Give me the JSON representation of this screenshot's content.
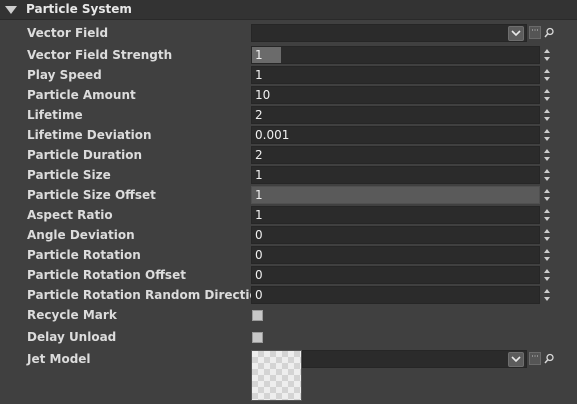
{
  "section": {
    "title": "Particle System"
  },
  "vector_field": {
    "label": "Vector Field",
    "value": ""
  },
  "properties": [
    {
      "label": "Vector Field Strength",
      "value": "1",
      "fill_fraction": 0.1
    },
    {
      "label": "Play Speed",
      "value": "1"
    },
    {
      "label": "Particle Amount",
      "value": "10"
    },
    {
      "label": "Lifetime",
      "value": "2"
    },
    {
      "label": "Lifetime Deviation",
      "value": "0.001"
    },
    {
      "label": "Particle Duration",
      "value": "2"
    },
    {
      "label": "Particle Size",
      "value": "1"
    },
    {
      "label": "Particle Size Offset",
      "value": "1",
      "highlighted": true
    },
    {
      "label": "Aspect Ratio",
      "value": "1"
    },
    {
      "label": "Angle Deviation",
      "value": "0"
    },
    {
      "label": "Particle Rotation",
      "value": "0"
    },
    {
      "label": "Particle Rotation Offset",
      "value": "0"
    },
    {
      "label": "Particle Rotation Random Direction",
      "value": "0"
    }
  ],
  "checkboxes": [
    {
      "label": "Recycle Mark",
      "checked": false
    },
    {
      "label": "Delay Unload",
      "checked": false
    }
  ],
  "jet_model": {
    "label": "Jet Model",
    "value": ""
  },
  "icons": {
    "collapse": "triangle-down-icon",
    "dropdown": "chevron-down-icon",
    "browse": "ellipsis-icon",
    "search": "search-icon"
  }
}
